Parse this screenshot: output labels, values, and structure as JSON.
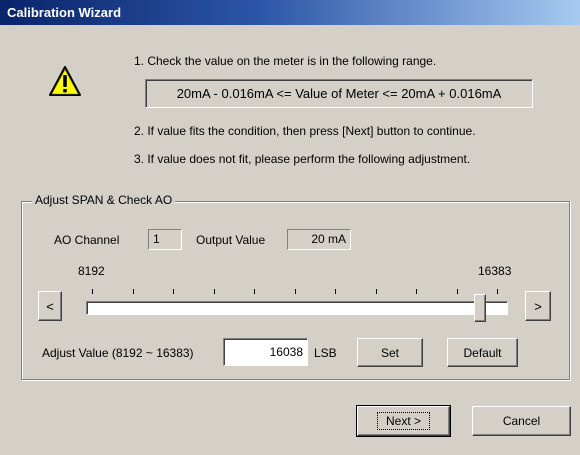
{
  "window": {
    "title": "Calibration Wizard"
  },
  "instructions": {
    "step1": "1. Check the value on the meter is in the following range.",
    "range": "20mA - 0.016mA <=  Value of Meter  <= 20mA + 0.016mA",
    "step2": "2. If value fits the condition, then press [Next] button to continue.",
    "step3": "3. If value does not fit, please perform the following adjustment."
  },
  "adjust_group": {
    "legend": "Adjust SPAN & Check AO",
    "ao_channel_label": "AO Channel",
    "ao_channel_value": "1",
    "output_value_label": "Output Value",
    "output_value": "20 mA",
    "slider": {
      "min_label": "8192",
      "max_label": "16383",
      "min": 8192,
      "max": 16383,
      "value": 16038,
      "left_arrow": "<",
      "right_arrow": ">"
    },
    "adjust_value_label": "Adjust Value (8192 ~ 16383)",
    "adjust_value": "16038",
    "unit": "LSB",
    "set_label": "Set",
    "default_label": "Default"
  },
  "footer": {
    "next_label": "Next >",
    "cancel_label": "Cancel"
  },
  "icons": {
    "warning": "warning-icon"
  }
}
